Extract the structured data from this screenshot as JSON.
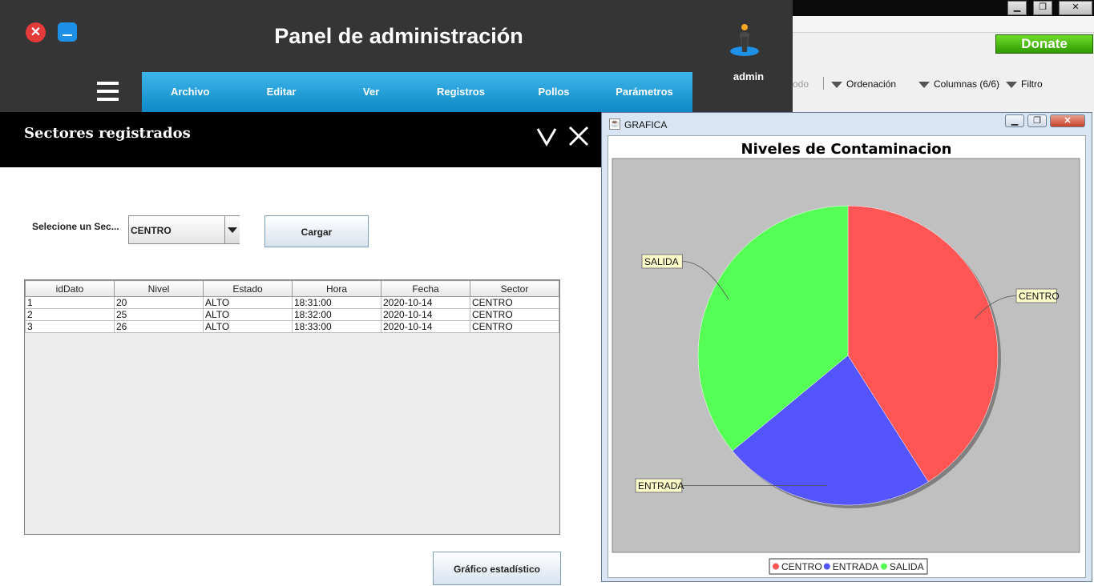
{
  "background_app": {
    "donate_label": "Donate",
    "toolbar": {
      "partial_label": "odo",
      "sort_label": "Ordenación",
      "columns_label": "Columnas (6/6)",
      "filter_label": "Filtro"
    }
  },
  "header": {
    "title": "Panel de administración",
    "user_name": "admin",
    "close_glyph": "✕",
    "menu": [
      "Archivo",
      "Editar",
      "Ver",
      "Registros",
      "Pollos",
      "Parámetros"
    ]
  },
  "section": {
    "title": "Sectores registrados"
  },
  "form": {
    "select_label": "Selecione un Sec...",
    "selected_sector": "CENTRO",
    "load_button": "Cargar",
    "stats_button": "Gráfico estadístico"
  },
  "table": {
    "columns": [
      "idDato",
      "Nivel",
      "Estado",
      "Hora",
      "Fecha",
      "Sector"
    ],
    "rows": [
      [
        "1",
        "20",
        "ALTO",
        "18:31:00",
        "2020-10-14",
        "CENTRO"
      ],
      [
        "2",
        "25",
        "ALTO",
        "18:32:00",
        "2020-10-14",
        "CENTRO"
      ],
      [
        "3",
        "26",
        "ALTO",
        "18:33:00",
        "2020-10-14",
        "CENTRO"
      ]
    ]
  },
  "chart_window": {
    "title": "GRAFICA"
  },
  "chart_data": {
    "type": "pie",
    "title": "Niveles de Contaminacion",
    "categories": [
      "CENTRO",
      "ENTRADA",
      "SALIDA"
    ],
    "values": [
      41,
      23,
      36
    ],
    "colors": [
      "#ff5555",
      "#5555ff",
      "#55ff55"
    ],
    "legend": "bottom",
    "plot_background": "#c0c0c0"
  },
  "colors": {
    "header_bg": "#353535",
    "menu_bar": "#1a9bd7",
    "close_button": "#e43a3a",
    "minimize_button": "#1e90e8"
  }
}
